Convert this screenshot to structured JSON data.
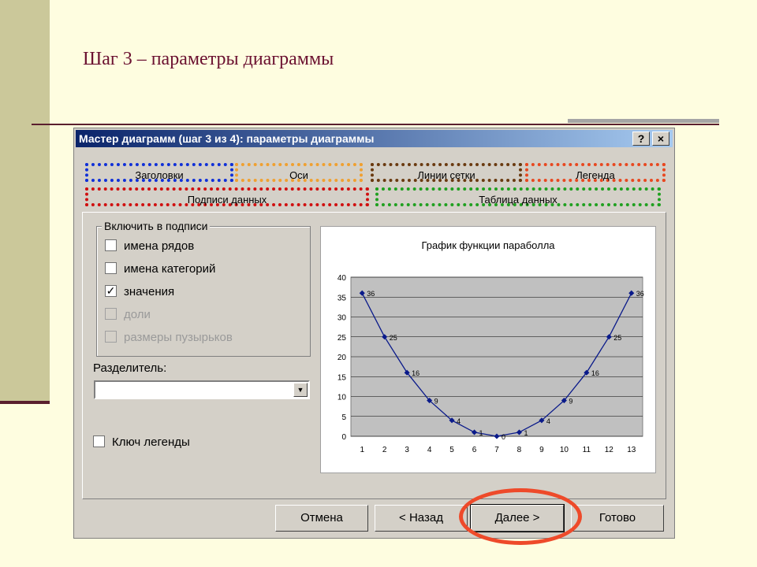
{
  "slide": {
    "title": "Шаг 3 – параметры диаграммы"
  },
  "dialog": {
    "title": "Мастер диаграмм (шаг 3 из 4): параметры диаграммы",
    "help_label": "?",
    "close_label": "×"
  },
  "tabs": [
    {
      "label": "Заголовки",
      "outline": "#1030d8"
    },
    {
      "label": "Оси",
      "outline": "#f0a030"
    },
    {
      "label": "Линии сетки",
      "outline": "#6a3a10"
    },
    {
      "label": "Легенда",
      "outline": "#e84820"
    },
    {
      "label": "Подписи данных",
      "outline": "#d01010"
    },
    {
      "label": "Таблица данных",
      "outline": "#20a020"
    }
  ],
  "labels_group": {
    "title": "Включить в подписи",
    "options": [
      {
        "label": "имена рядов",
        "checked": false,
        "enabled": true
      },
      {
        "label": "имена категорий",
        "checked": false,
        "enabled": true
      },
      {
        "label": "значения",
        "checked": true,
        "enabled": true
      },
      {
        "label": "доли",
        "checked": false,
        "enabled": false
      },
      {
        "label": "размеры пузырьков",
        "checked": false,
        "enabled": false
      }
    ]
  },
  "separator": {
    "label": "Разделитель:",
    "value": ""
  },
  "legend_key": {
    "label": "Ключ легенды",
    "checked": false
  },
  "buttons": {
    "cancel": "Отмена",
    "back": "< Назад",
    "next": "Далее >",
    "finish": "Готово"
  },
  "chart_data": {
    "type": "line",
    "title": "График функции параболла",
    "categories": [
      "1",
      "2",
      "3",
      "4",
      "5",
      "6",
      "7",
      "8",
      "9",
      "10",
      "11",
      "12",
      "13"
    ],
    "series": [
      {
        "values": [
          36,
          25,
          16,
          9,
          4,
          1,
          0,
          1,
          4,
          9,
          16,
          25,
          36
        ]
      }
    ],
    "data_labels": [
      "36",
      "25",
      "16",
      "9",
      "4",
      "1",
      "0",
      "1",
      "4",
      "9",
      "16",
      "25",
      "36"
    ],
    "ylim": [
      0,
      40
    ],
    "yticks": [
      "0",
      "5",
      "10",
      "15",
      "20",
      "25",
      "30",
      "35",
      "40"
    ],
    "grid": true,
    "plot_background": "#c0c0c0",
    "line_color": "#0a1a8a"
  }
}
